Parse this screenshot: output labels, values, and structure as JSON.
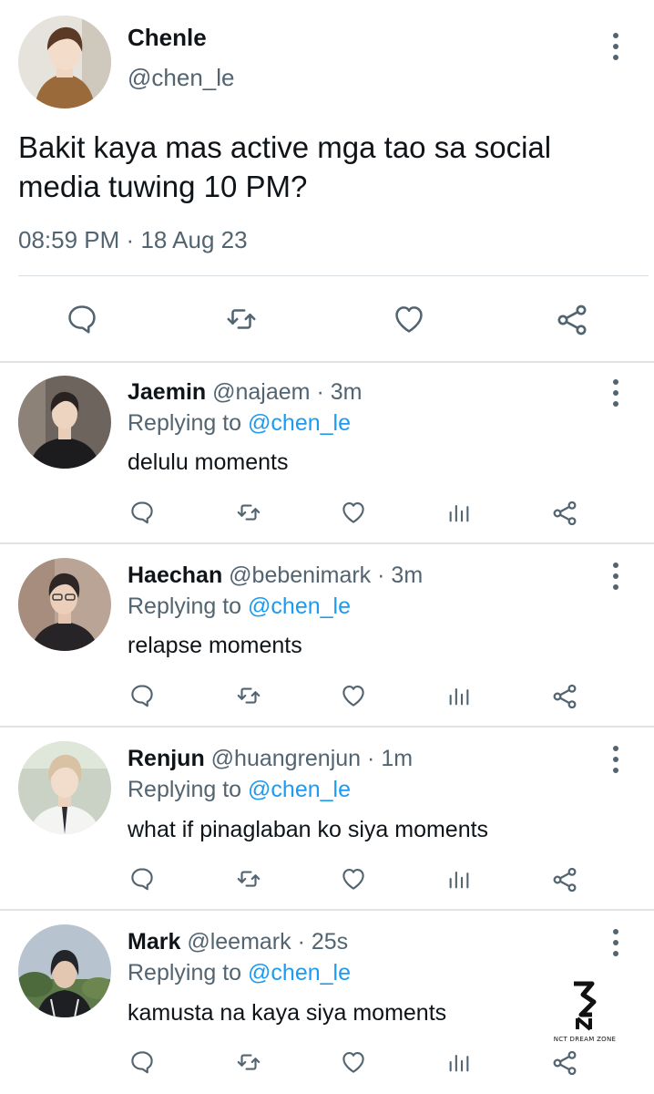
{
  "tweet": {
    "name": "Chenle",
    "handle": "@chen_le",
    "text": "Bakit kaya mas active mga tao sa social media tuwing 10 PM?",
    "time": "08:59 PM",
    "date_sep": "·",
    "date": "18 Aug 23"
  },
  "colors": {
    "accent": "#1d9bf0",
    "text": "#0f1419",
    "secondary": "#536471",
    "divider": "#dfe3e6"
  },
  "replies": [
    {
      "name": "Jaemin",
      "handle": "@najaem",
      "sep": "·",
      "time": "3m",
      "replying_prefix": "Replying to",
      "replying_to": "@chen_le",
      "text": "delulu moments"
    },
    {
      "name": "Haechan",
      "handle": "@bebenimark",
      "sep": "·",
      "time": "3m",
      "replying_prefix": "Replying to",
      "replying_to": "@chen_le",
      "text": "relapse moments"
    },
    {
      "name": "Renjun",
      "handle": "@huangrenjun",
      "sep": "·",
      "time": "1m",
      "replying_prefix": "Replying to",
      "replying_to": "@chen_le",
      "text": "what if pinaglaban ko siya moments"
    },
    {
      "name": "Mark",
      "handle": "@leemark",
      "sep": "·",
      "time": "25s",
      "replying_prefix": "Replying to",
      "replying_to": "@chen_le",
      "text": "kamusta na kaya siya moments"
    }
  ],
  "icons": [
    "reply-icon",
    "retweet-icon",
    "like-icon",
    "views-icon",
    "share-icon",
    "more-icon"
  ],
  "watermark": {
    "text": "NCT DREAM ZONE"
  }
}
